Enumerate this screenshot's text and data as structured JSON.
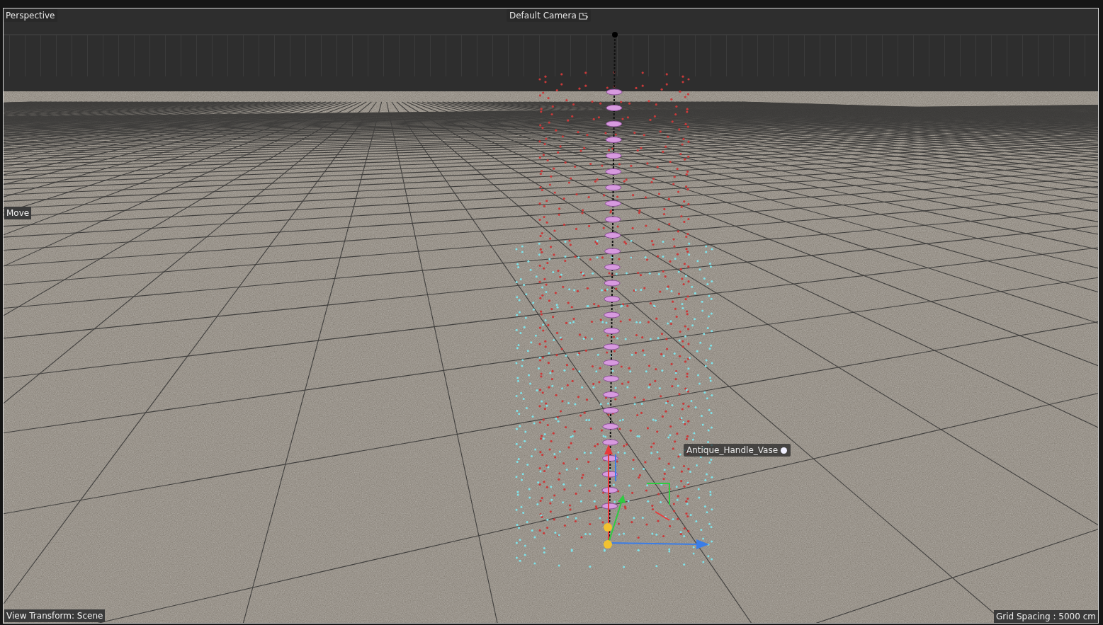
{
  "viewport": {
    "view_name": "Perspective",
    "camera": "Default Camera",
    "tool": "Move",
    "object_label": "Antique_Handle_Vase",
    "view_transform": "View Transform: Scene",
    "grid_spacing": "Grid Spacing : 5000 cm"
  }
}
